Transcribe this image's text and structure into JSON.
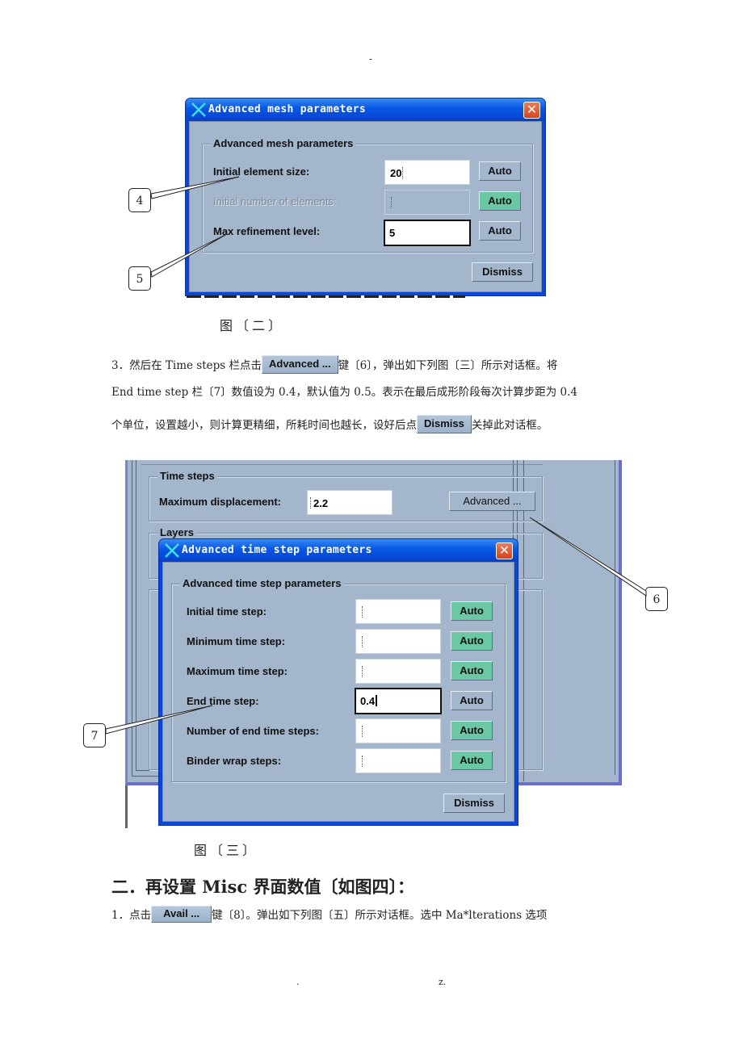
{
  "page": {
    "header_mark": "-",
    "footer_left": ".",
    "footer_right": "z."
  },
  "figure2": {
    "caption": "图〔二〕",
    "dialog": {
      "title": "Advanced mesh parameters",
      "group_label": "Advanced mesh parameters",
      "rows": [
        {
          "label": "Initial element size:",
          "value": "20",
          "state": "normal",
          "auto_label": "Auto",
          "auto_active": false
        },
        {
          "label": "Initial number of elements:",
          "value": "",
          "state": "disabled",
          "auto_label": "Auto",
          "auto_active": true
        },
        {
          "label": "Max refinement level:",
          "value": "5",
          "state": "focused",
          "auto_label": "Auto",
          "auto_active": false
        }
      ],
      "dismiss_label": "Dismiss",
      "close_icon": "close-icon"
    },
    "callouts": [
      "4",
      "5"
    ]
  },
  "paragraph3": {
    "line1_before": "3．然后在 Time  steps 栏点击",
    "button": "Advanced ...",
    "line1_after": "键〔6〕，弹出如下列图〔三〕所示对话框。将",
    "line2": "End time step 栏〔7〕数值设为 0.4，默认值为 0.5。表示在最后成形阶段每次计算步距为 0.4",
    "line3_before": "个单位，设置越小，则计算更精细，所耗时间也越长，设好后点",
    "button2": "Dismiss",
    "line3_after": "关掉此对话框。"
  },
  "figure3": {
    "caption": "图〔三〕",
    "background_window": {
      "time_steps_group": "Time steps",
      "max_disp_label": "Maximum displacement:",
      "max_disp_value": "2.2",
      "advanced_button": "Advanced ...",
      "layers_group": "Layers"
    },
    "dialog": {
      "title": "Advanced time step parameters",
      "group_label": "Advanced time step parameters",
      "rows": [
        {
          "label": "Initial time step:",
          "value": "",
          "state": "normal",
          "auto_label": "Auto",
          "auto_active": true
        },
        {
          "label": "Minimum time step:",
          "value": "",
          "state": "normal",
          "auto_label": "Auto",
          "auto_active": true
        },
        {
          "label": "Maximum time step:",
          "value": "",
          "state": "normal",
          "auto_label": "Auto",
          "auto_active": true
        },
        {
          "label": "End time step:",
          "value": "0.4",
          "state": "focused",
          "auto_label": "Auto",
          "auto_active": false
        },
        {
          "label": "Number of end time steps:",
          "value": "",
          "state": "normal",
          "auto_label": "Auto",
          "auto_active": true
        },
        {
          "label": "Binder wrap steps:",
          "value": "",
          "state": "normal",
          "auto_label": "Auto",
          "auto_active": true
        }
      ],
      "dismiss_label": "Dismiss"
    },
    "callouts": [
      "6",
      "7"
    ]
  },
  "section2": {
    "heading": "二．再设置 Misc 界面数值〔如图四〕：",
    "line1_before": "1．点击",
    "button": "Avail ...",
    "line1_after": "键〔8〕。弹出如下列图〔五〕所示对话框。选中 Ma*lterations 选项"
  },
  "colors": {
    "xp_blue": "#0a5ae6",
    "dialog_bg": "#a3b6cc",
    "auto_active": "#6ac9a4",
    "close_red": "#d8441c"
  }
}
